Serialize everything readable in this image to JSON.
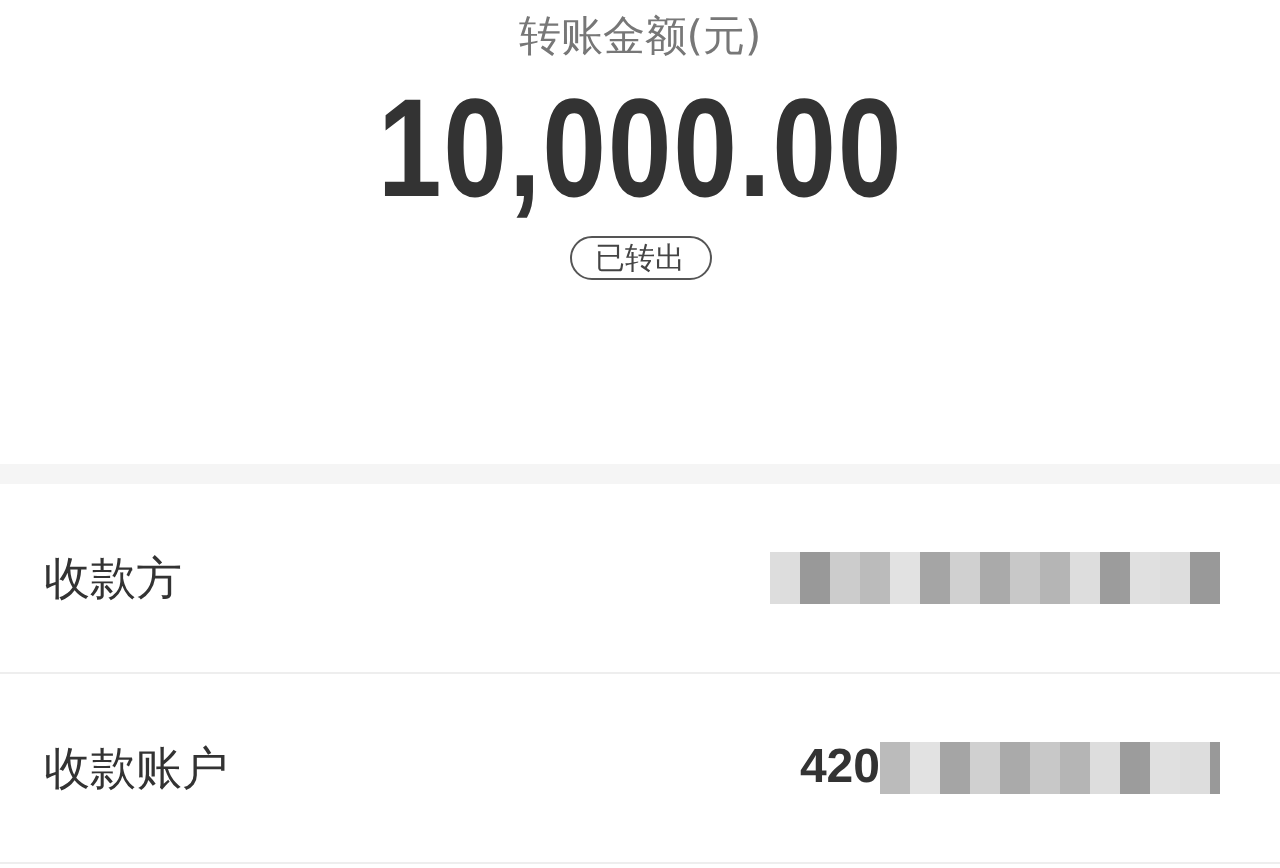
{
  "amount_label": "转账金额(元)",
  "amount": "10,000.00",
  "status": "已转出",
  "rows": [
    {
      "label": "收款方",
      "value": "",
      "redacted": true
    },
    {
      "label": "收款账户",
      "value": "420",
      "redacted": true
    }
  ]
}
